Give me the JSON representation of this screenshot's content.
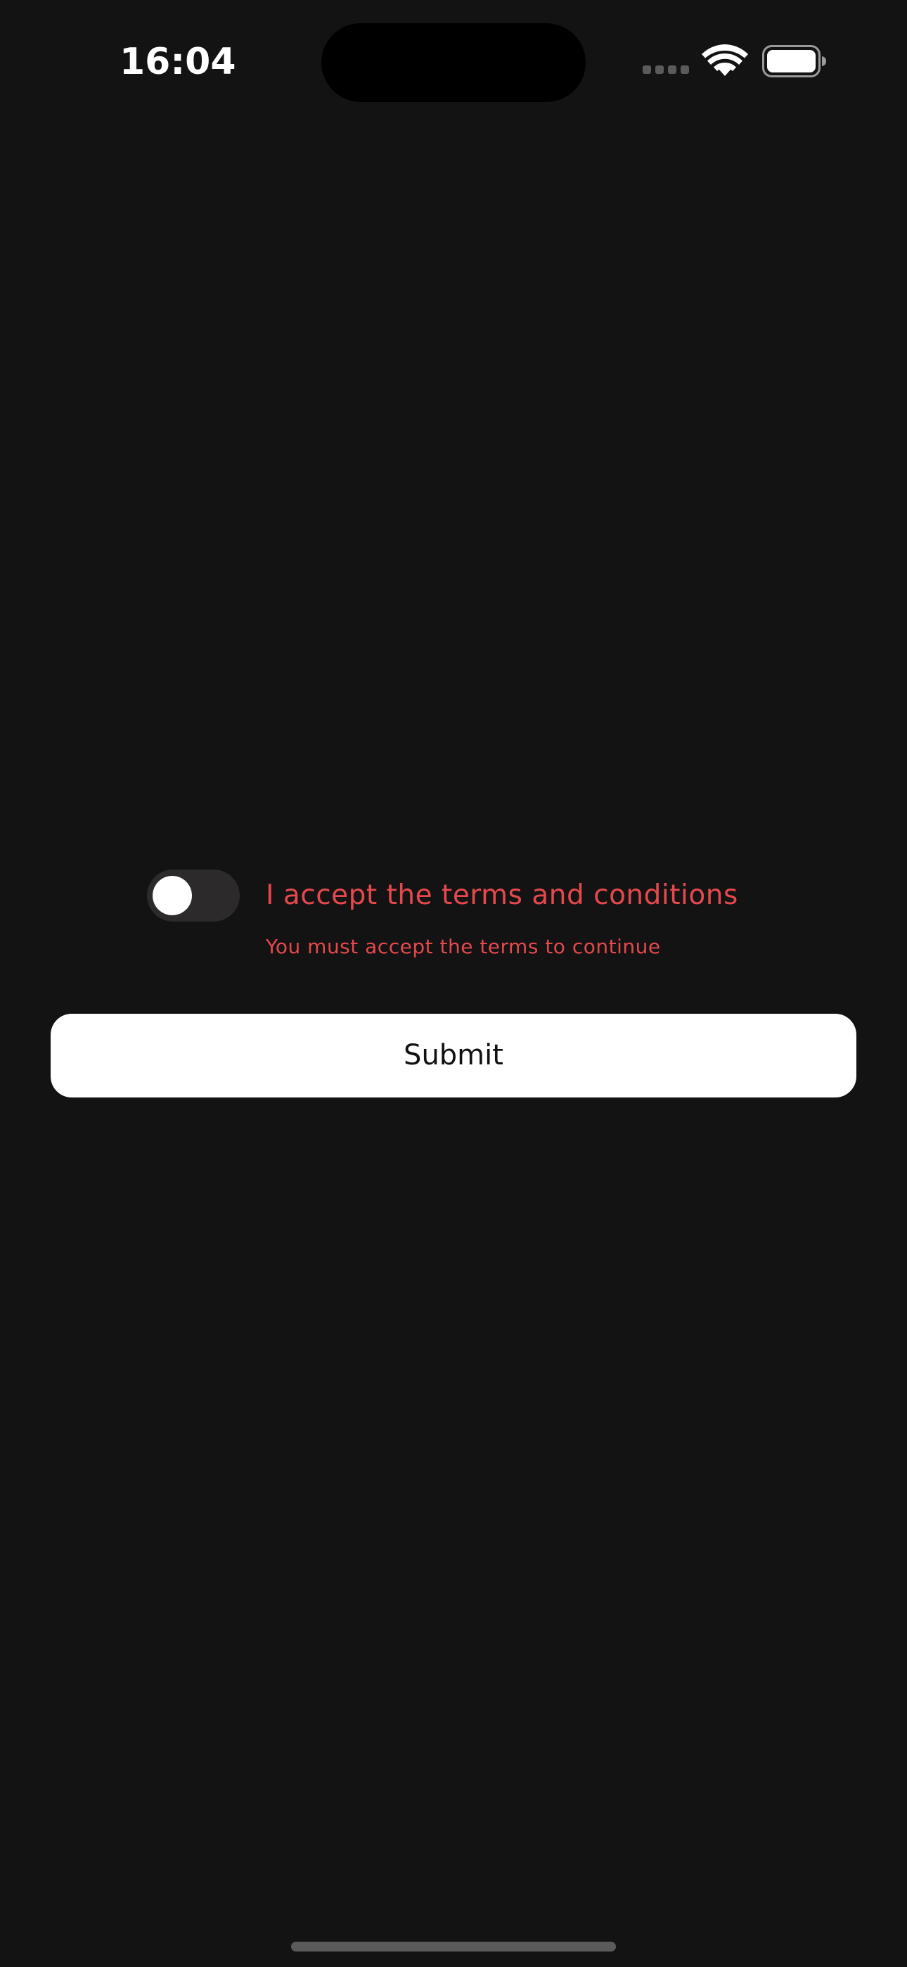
{
  "status_bar": {
    "time": "16:04",
    "signal_icon": "cellular-signal-icon",
    "wifi_icon": "wifi-icon",
    "battery_icon": "battery-full-icon"
  },
  "form": {
    "terms_toggle": {
      "checked": false,
      "label": "I accept the terms and conditions",
      "error": "You must accept the terms to continue"
    },
    "submit_label": "Submit"
  },
  "colors": {
    "background": "#131313",
    "error": "#e5484d",
    "button_background": "#ffffff",
    "toggle_off": "#2c2a2a"
  }
}
